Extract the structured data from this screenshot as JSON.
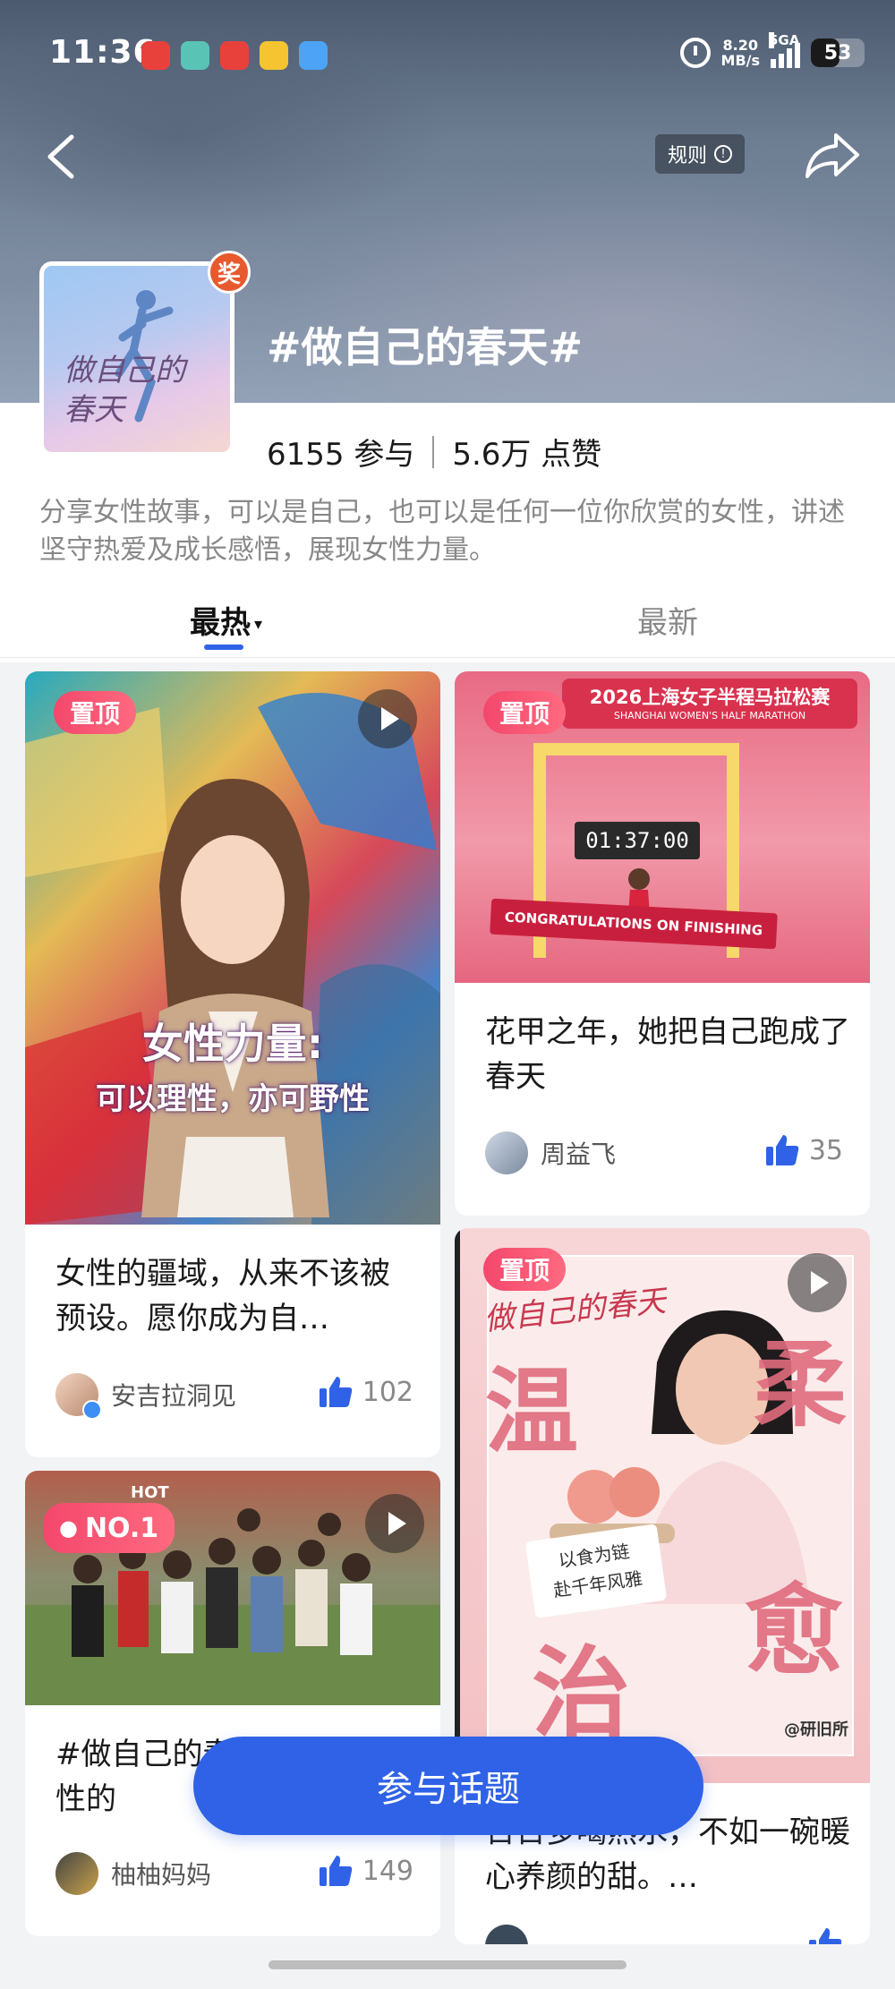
{
  "status_bar": {
    "time": "11:36",
    "net_speed_value": "8.20",
    "net_speed_unit": "MB/s",
    "signal_label": "5GA",
    "battery": "53",
    "battery_level": 0.53,
    "notification_colors": [
      "#e8413c",
      "#59c3b5",
      "#e8413c",
      "#f6c430",
      "#4da3f5"
    ]
  },
  "header": {
    "rules_label": "规则",
    "topic_title": "#做自己的春天#",
    "cover_text": "做自己的\n春天",
    "award_badge": "奖",
    "participants": "6155 参与",
    "likes": "5.6万 点赞",
    "description": "分享女性故事，可以是自己，也可以是任何一位你欣赏的女性，讲述坚守热爱及成长感悟，展现女性力量。"
  },
  "tabs": [
    {
      "label": "最热",
      "active": true
    },
    {
      "label": "最新",
      "active": false
    }
  ],
  "posts": [
    {
      "badge": "置顶",
      "overlay_line1": "女性力量:",
      "overlay_line2": "可以理性，亦可野性",
      "title": "女性的疆域，从来不该被预设。愿你成为自…",
      "author": "安吉拉洞见",
      "likes": "102"
    },
    {
      "badge": "置顶",
      "banner_text": "2026上海女子半程马拉松赛",
      "banner_sub": "SHANGHAI WOMEN'S HALF MARATHON",
      "timer": "01:37:00",
      "ribbon": "CONGRATULATIONS ON FINISHING",
      "title": "花甲之年，她把自己跑成了春天",
      "author": "周益飞",
      "likes": "35"
    },
    {
      "badge": "NO.1",
      "hot": "HOT",
      "title": "#做自己的春天# 一位女性的",
      "author": "柚柚妈妈",
      "likes": "149"
    },
    {
      "badge": "置顶",
      "poster_big1": "温",
      "poster_big2": "柔",
      "poster_big3": "治",
      "poster_big4": "愈",
      "poster_caption_line1": "以食为链",
      "poster_caption_line2": "赴千年风雅",
      "poster_mark": "@研旧所",
      "poster_topic": "做自己的春天",
      "title": "日日多喝热水，不如一碗暖心养颜的甜。…"
    }
  ],
  "cta_label": "参与话题",
  "accent_color": "#2f62e6"
}
